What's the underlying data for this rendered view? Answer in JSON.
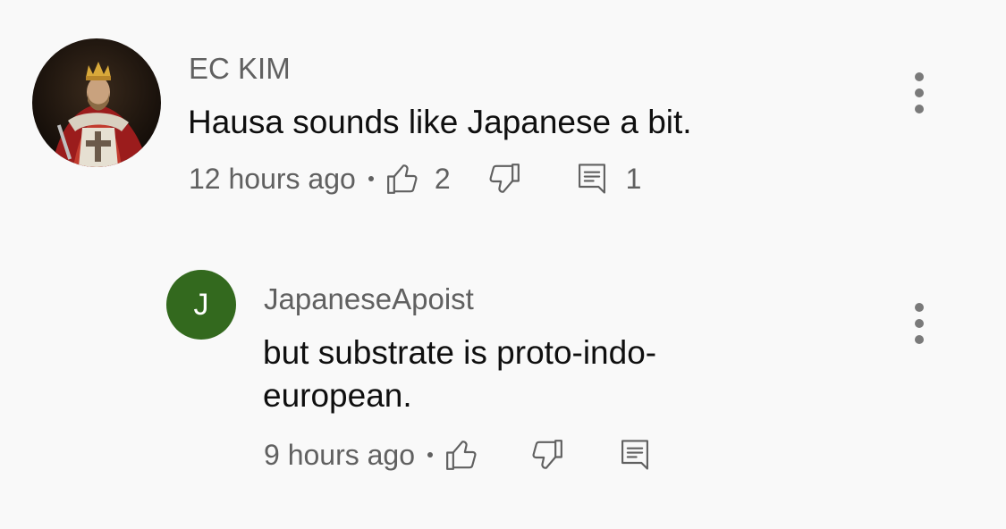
{
  "comments": [
    {
      "author": "EC KIM",
      "text": "Hausa sounds like Japanese a bit.",
      "time": "12 hours ago",
      "likes": "2",
      "replies": "1",
      "avatar_icon": "knight-portrait-icon"
    }
  ],
  "reply": {
    "author": "JapaneseApoist",
    "avatar_letter": "J",
    "avatar_color": "#33691e",
    "text_line1": "but substrate is proto-indo-",
    "text_line2": "european.",
    "time": "9 hours ago"
  },
  "icons": {
    "like": "thumbs-up-icon",
    "dislike": "thumbs-down-icon",
    "reply": "reply-comment-icon",
    "more": "more-vertical-icon"
  }
}
